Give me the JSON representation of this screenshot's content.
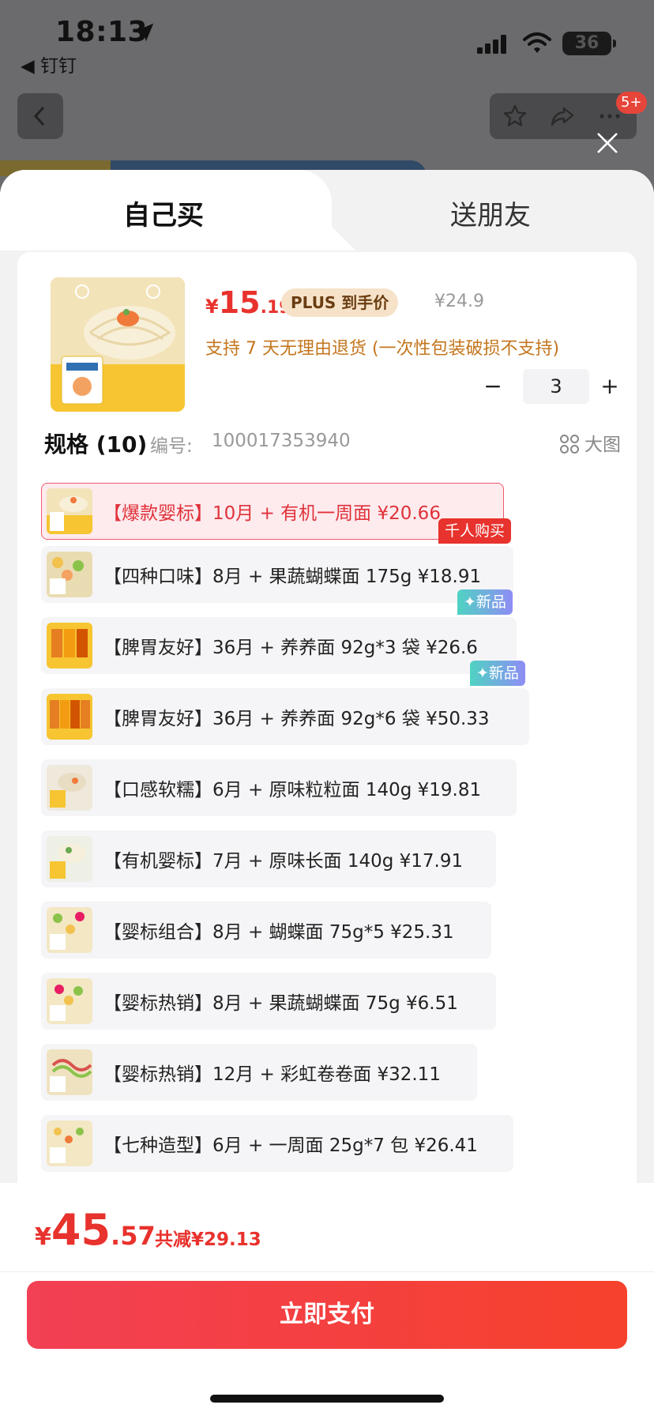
{
  "status_bar": {
    "time": "18:13",
    "back_app": "◀ 钉钉",
    "battery": "36"
  },
  "nav": {
    "badge": "5+"
  },
  "tabs": [
    {
      "label": "自己买",
      "active": true
    },
    {
      "label": "送朋友",
      "active": false
    }
  ],
  "product": {
    "price_symbol": "¥",
    "price_int": "15",
    "price_dec": ".19",
    "plus_label": "PLUS 到手价",
    "original_price": "¥24.9",
    "return_policy": "支持 7 天无理由退货 (一次性包装破损不支持)",
    "quantity": "3",
    "minus_label": "−",
    "plus_btn_label": "+"
  },
  "spec": {
    "title": "规格 (10)",
    "code_label": "编号:",
    "code": "100017353940",
    "big_view_label": "大图",
    "items": [
      {
        "text": "【爆款婴标】10月 + 有机一周面   ¥20.66",
        "selected": true,
        "tag": null
      },
      {
        "text": "【四种口味】8月 + 果蔬蝴蝶面 175g   ¥18.91",
        "selected": false,
        "tag": "千人购买"
      },
      {
        "text": "【脾胃友好】36月 + 养养面 92g*3 袋   ¥26.6",
        "selected": false,
        "tag": "✦新品"
      },
      {
        "text": "【脾胃友好】36月 + 养养面 92g*6 袋   ¥50.33",
        "selected": false,
        "tag": "✦新品"
      },
      {
        "text": "【口感软糯】6月 + 原味粒粒面 140g   ¥19.81",
        "selected": false,
        "tag": null
      },
      {
        "text": "【有机婴标】7月 + 原味长面 140g   ¥17.91",
        "selected": false,
        "tag": null
      },
      {
        "text": "【婴标组合】8月 + 蝴蝶面 75g*5   ¥25.31",
        "selected": false,
        "tag": null
      },
      {
        "text": "【婴标热销】8月 + 果蔬蝴蝶面 75g   ¥6.51",
        "selected": false,
        "tag": null
      },
      {
        "text": "【婴标热销】12月 + 彩虹卷卷面   ¥32.11",
        "selected": false,
        "tag": null
      },
      {
        "text": "【七种造型】6月 + 一周面 25g*7 包   ¥26.41",
        "selected": false,
        "tag": null
      }
    ]
  },
  "footer": {
    "total_symbol": "¥",
    "total_int": "45",
    "total_dec": ".57",
    "saving": "共减¥29.13",
    "pay_label": "立即支付"
  },
  "colors": {
    "accent_red": "#e8322d",
    "selected_bg": "#fdebee",
    "pay_gradient_start": "#f24054",
    "pay_gradient_end": "#f6412c"
  }
}
